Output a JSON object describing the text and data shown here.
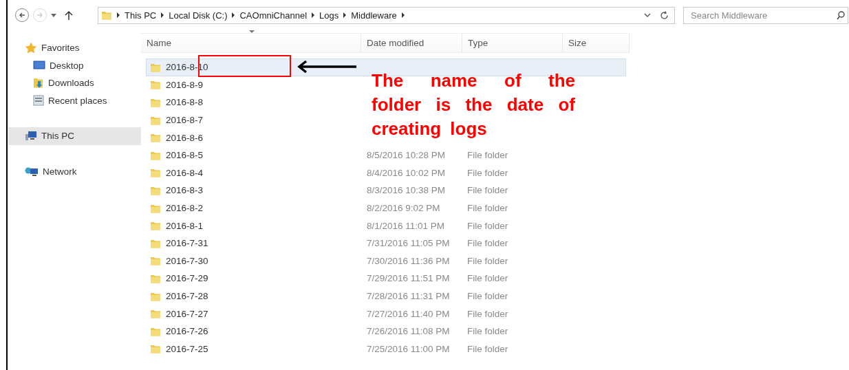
{
  "navigation": {
    "back_enabled": true,
    "forward_enabled": false
  },
  "address_bar": {
    "path": [
      "This PC",
      "Local Disk (C:)",
      "CAOmniChannel",
      "Logs",
      "Middleware"
    ]
  },
  "search": {
    "placeholder": "Search Middleware"
  },
  "sidebar": {
    "items": [
      {
        "label": "Favorites",
        "kind": "star",
        "selected": false,
        "children": [
          {
            "label": "Desktop",
            "kind": "desktop",
            "selected": false
          },
          {
            "label": "Downloads",
            "kind": "downloads",
            "selected": false
          },
          {
            "label": "Recent places",
            "kind": "recent",
            "selected": false
          }
        ]
      },
      {
        "label": "This PC",
        "kind": "computer",
        "selected": true
      },
      {
        "label": "Network",
        "kind": "network",
        "selected": false
      }
    ]
  },
  "table": {
    "columns": [
      "Name",
      "Date modified",
      "Type",
      "Size"
    ],
    "rows": [
      {
        "name": "2016-8-10",
        "selected": true
      },
      {
        "name": "2016-8-9",
        "selected": false
      },
      {
        "name": "2016-8-8",
        "selected": false
      },
      {
        "name": "2016-8-7",
        "selected": false
      },
      {
        "name": "2016-8-6",
        "selected": false
      },
      {
        "name": "2016-8-5",
        "date_modified": "8/5/2016 10:28 PM",
        "type": "File folder",
        "selected": false
      },
      {
        "name": "2016-8-4",
        "date_modified": "8/4/2016 10:02 PM",
        "type": "File folder",
        "selected": false
      },
      {
        "name": "2016-8-3",
        "date_modified": "8/3/2016 10:38 PM",
        "type": "File folder",
        "selected": false
      },
      {
        "name": "2016-8-2",
        "date_modified": "8/2/2016 9:02 PM",
        "type": "File folder",
        "selected": false
      },
      {
        "name": "2016-8-1",
        "date_modified": "8/1/2016 11:01 PM",
        "type": "File folder",
        "selected": false
      },
      {
        "name": "2016-7-31",
        "date_modified": "7/31/2016 11:05 PM",
        "type": "File folder",
        "selected": false
      },
      {
        "name": "2016-7-30",
        "date_modified": "7/30/2016 11:36 PM",
        "type": "File folder",
        "selected": false
      },
      {
        "name": "2016-7-29",
        "date_modified": "7/29/2016 11:51 PM",
        "type": "File folder",
        "selected": false
      },
      {
        "name": "2016-7-28",
        "date_modified": "7/28/2016 11:31 PM",
        "type": "File folder",
        "selected": false
      },
      {
        "name": "2016-7-27",
        "date_modified": "7/27/2016 11:40 PM",
        "type": "File folder",
        "selected": false
      },
      {
        "name": "2016-7-26",
        "date_modified": "7/26/2016 11:08 PM",
        "type": "File folder",
        "selected": false
      },
      {
        "name": "2016-7-25",
        "date_modified": "7/25/2016 11:00 PM",
        "type": "File folder",
        "selected": false
      }
    ]
  },
  "annotation": {
    "callout": "The name of the folder is the date of creating logs"
  }
}
